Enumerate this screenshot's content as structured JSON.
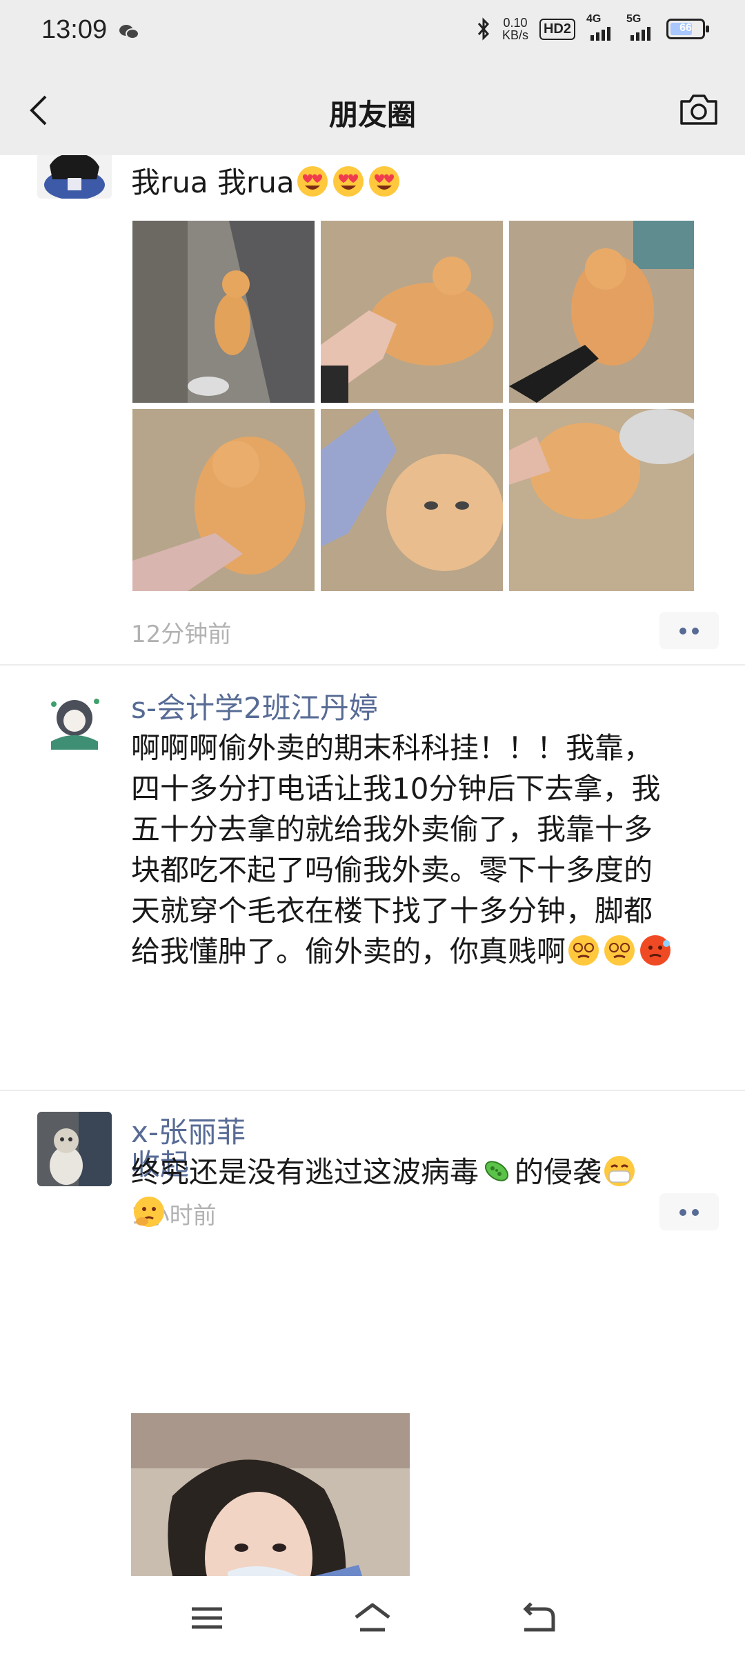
{
  "status": {
    "time": "13:09",
    "speed_value": "0.10",
    "speed_unit": "KB/s",
    "hd": "HD2",
    "net1": "4G",
    "net2": "5G",
    "battery": "66"
  },
  "nav": {
    "title": "朋友圈"
  },
  "posts": [
    {
      "text": "我rua 我rua",
      "emojis": [
        "heart-eyes-emoji",
        "heart-eyes-emoji",
        "heart-eyes-emoji"
      ],
      "time": "12分钟前"
    },
    {
      "author": "s-会计学2班江丹婷",
      "lines": [
        "啊啊啊偷外卖的期末科科挂！！！我靠，",
        "四十多分打电话让我10分钟后下去拿，我",
        "五十分去拿的就给我外卖偷了，我靠十多",
        "块都吃不起了吗偷我外卖。零下十多度的",
        "天就穿个毛衣在楼下找了十多分钟，脚都",
        "给我懂肿了。偷外卖的，你真贱啊"
      ],
      "collapse": "收起",
      "time": "1小时前"
    },
    {
      "author": "x-张丽菲",
      "text_a": "终究还是没有逃过这波病毒",
      "text_b": "的侵袭"
    }
  ]
}
